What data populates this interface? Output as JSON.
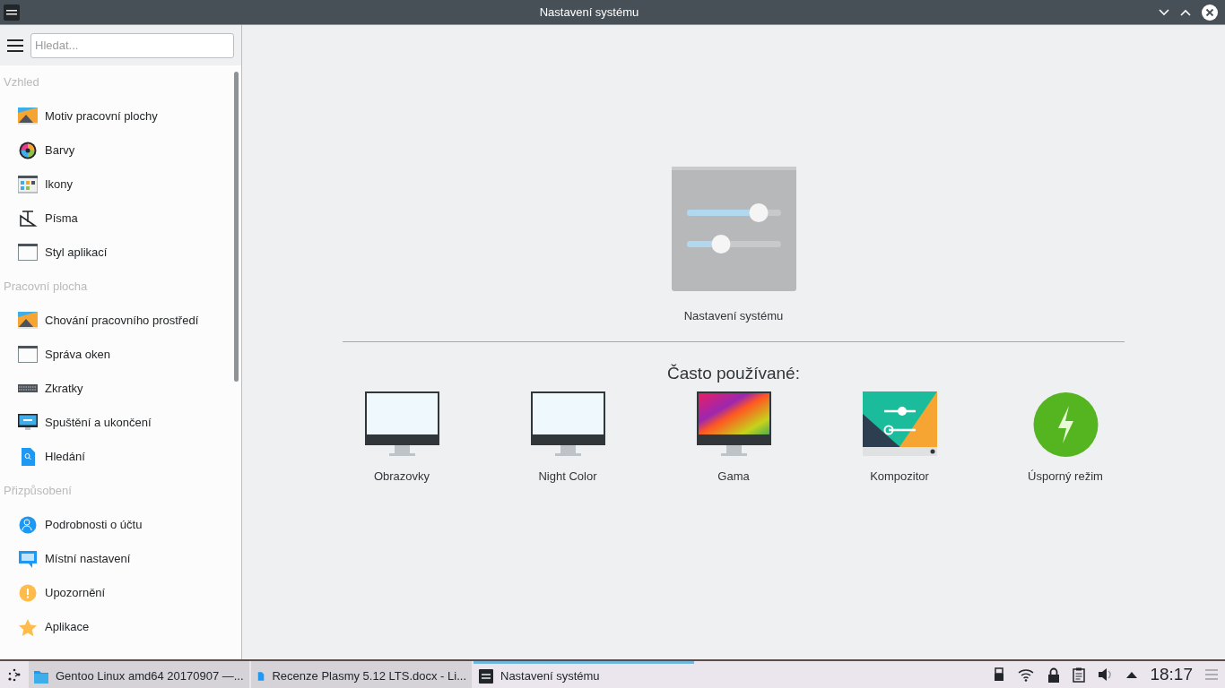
{
  "window": {
    "title": "Nastavení systému"
  },
  "search": {
    "placeholder": "Hledat..."
  },
  "sidebar": {
    "sections": [
      {
        "title": "Vzhled",
        "items": [
          {
            "label": "Motiv pracovní plochy",
            "kind": "landscape"
          },
          {
            "label": "Barvy",
            "kind": "colorwheel"
          },
          {
            "label": "Ikony",
            "kind": "iconsgrid"
          },
          {
            "label": "Písma",
            "kind": "font"
          },
          {
            "label": "Styl aplikací",
            "kind": "window"
          }
        ]
      },
      {
        "title": "Pracovní plocha",
        "items": [
          {
            "label": "Chování pracovního prostředí",
            "kind": "landscape"
          },
          {
            "label": "Správa oken",
            "kind": "window"
          },
          {
            "label": "Zkratky",
            "kind": "keyboard"
          },
          {
            "label": "Spuštění a ukončení",
            "kind": "monitor"
          },
          {
            "label": "Hledání",
            "kind": "searchdoc"
          }
        ]
      },
      {
        "title": "Přizpůsobení",
        "items": [
          {
            "label": "Podrobnosti o účtu",
            "kind": "user"
          },
          {
            "label": "Místní nastavení",
            "kind": "chat"
          },
          {
            "label": "Upozornění",
            "kind": "warning"
          },
          {
            "label": "Aplikace",
            "kind": "star"
          }
        ]
      }
    ]
  },
  "main": {
    "title": "Nastavení systému",
    "frequent_heading": "Často používané:",
    "frequent": [
      {
        "label": "Obrazovky",
        "kind": "monitor"
      },
      {
        "label": "Night Color",
        "kind": "monitor"
      },
      {
        "label": "Gama",
        "kind": "gamma"
      },
      {
        "label": "Kompozitor",
        "kind": "compositor"
      },
      {
        "label": "Úsporný režim",
        "kind": "power"
      }
    ]
  },
  "taskbar": {
    "tasks": [
      {
        "label": "Gentoo Linux amd64 20170907 —...",
        "kind": "folder",
        "selected": false
      },
      {
        "label": "Recenze Plasmy 5.12 LTS.docx - Li...",
        "kind": "document",
        "selected": false
      },
      {
        "label": "Nastavení systému",
        "kind": "settings",
        "selected": true
      }
    ],
    "clock": "18:17"
  }
}
